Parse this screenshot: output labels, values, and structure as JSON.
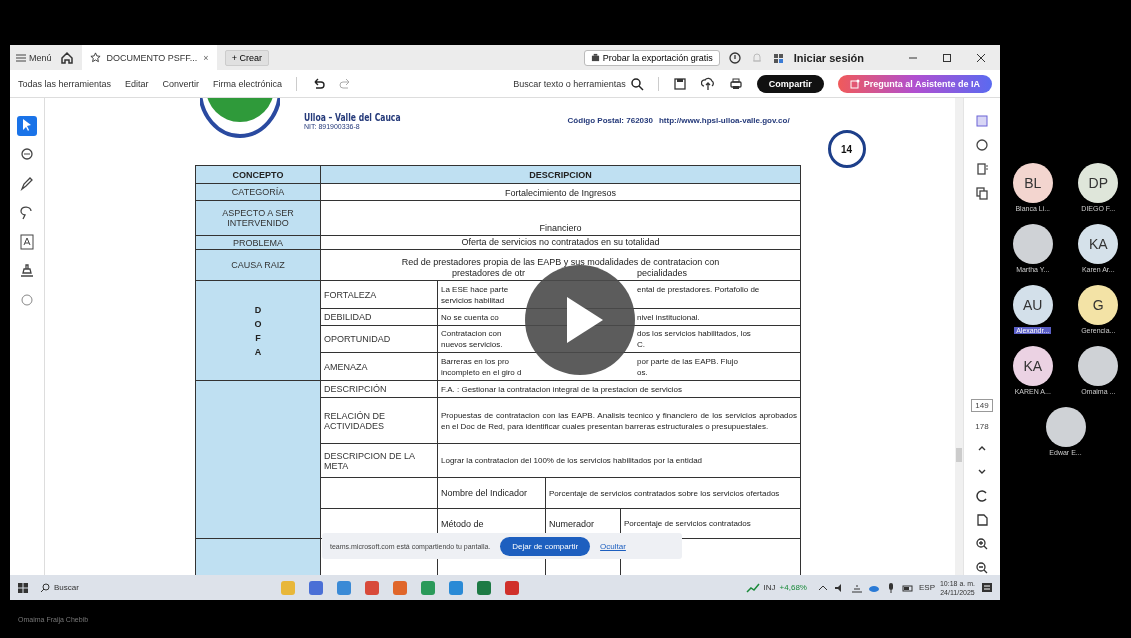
{
  "tab_bar": {
    "menu": "Menú",
    "tab_title": "DOCUMENTO PSFF...",
    "tab_close": "×",
    "create": "+ Crear",
    "try_export": "Probar la exportación gratis",
    "sign_in": "Iniciar sesión"
  },
  "toolbar": {
    "items": [
      "Todas las herramientas",
      "Editar",
      "Convertir",
      "Firma electrónica"
    ],
    "search": "Buscar texto o herramientas",
    "share": "Compartir",
    "ai": "Pregunta al Asistente de IA"
  },
  "left_tools": [
    {
      "kind": "pointer",
      "selected": true
    },
    {
      "kind": "comment",
      "selected": false
    },
    {
      "kind": "pen",
      "selected": false
    },
    {
      "kind": "lasso",
      "selected": false
    },
    {
      "kind": "text",
      "selected": false
    },
    {
      "kind": "stamp",
      "selected": false
    },
    {
      "kind": "circle",
      "selected": false
    }
  ],
  "document": {
    "header": {
      "town": "Ulloa – Valle del Cauca",
      "nit": "NIT: 891900336-8",
      "postal": "Código Postal: 762030",
      "url": "http://www.hpsl-ulloa-valle.gov.co/"
    },
    "page_badge": "14",
    "table": {
      "columns": [
        "CONCEPTO",
        "DESCRIPCION"
      ],
      "rows": [
        {
          "kind": "full",
          "label": "CATEGORÍA",
          "lines": [
            [
              "Fortalecimiento de Ingresos"
            ]
          ]
        },
        {
          "kind": "full",
          "label": "ASPECTO A SER INTERVENIDO",
          "lines": [
            [
              "Financiero"
            ]
          ]
        },
        {
          "kind": "full",
          "label": "PROBLEMA",
          "lines": [
            [
              "Oferta de servicios no contratados en su totalidad"
            ]
          ]
        },
        {
          "kind": "full",
          "label": "CAUSA RAIZ",
          "lines": [
            [
              "Red de prestadores propia de las EAPB y sus modalidades de contratacion con"
            ],
            [
              "prestadores de otr",
              "pecialidades"
            ]
          ]
        },
        {
          "kind": "group",
          "letters": [
            "D",
            "O",
            "F",
            "A"
          ],
          "children": [
            {
              "kind": "sub",
              "label": "FORTALEZA",
              "lines": [
                [
                  "La ESE hace parte",
                  "ental de prestadores. Portafolio de"
                ],
                [
                  "servicios habilitad"
                ]
              ]
            },
            {
              "kind": "sub",
              "label": "DEBILIDAD",
              "lines": [
                [
                  "No se cuenta co",
                  "nivel institucional."
                ]
              ]
            },
            {
              "kind": "sub",
              "label": "OPORTUNIDAD",
              "lines": [
                [
                  "Contratacion con",
                  "dos los servicios habilitados, los"
                ],
                [
                  "nuevos servicios.",
                  "C."
                ]
              ]
            },
            {
              "kind": "sub",
              "label": "AMENAZA",
              "lines": [
                [
                  "Barreras en los pro",
                  "por parte de las EAPB. Flujo"
                ],
                [
                  "incompleto en el giro d",
                  "os."
                ]
              ]
            }
          ]
        },
        {
          "kind": "group",
          "letters": [],
          "children": [
            {
              "kind": "sub",
              "label": "DESCRIPCIÓN",
              "lines": [
                [
                  "F.A. : Gestionar la contratacion integral de la prestacion de servicios"
                ]
              ]
            },
            {
              "kind": "sub",
              "label": "RELACIÓN DE ACTIVIDADES",
              "lines": [
                [
                  "Propuestas de contratacion con las EAPB. Analisis tecnico y financiero de los servicios aprobados en el Doc de Red, para identificar cuales presentan barreras estructurales o presupuestales."
                ]
              ]
            },
            {
              "kind": "sub",
              "label": "DESCRIPCION DE LA META",
              "lines": [
                [
                  "Lograr la contratacion del 100% de los servicios habilitados por la entidad"
                ]
              ]
            },
            {
              "kind": "indicator",
              "label": "Nombre del Indicador",
              "lines": [
                [
                  "Porcentaje de servicios contratados sobre los servicios ofertados"
                ]
              ]
            },
            {
              "kind": "method",
              "label": "Método de",
              "sublabel": "Numerador",
              "lines": [
                [
                  "Porcentaje de servicios contratados"
                ]
              ]
            }
          ]
        }
      ]
    }
  },
  "right_panel": {
    "page_current": "149",
    "page_total": "178"
  },
  "share_bar": {
    "message": "teams.microsoft.com está compartiendo tu pantalla.",
    "stop": "Dejar de compartir",
    "hide": "Ocultar"
  },
  "taskbar": {
    "search": "Buscar",
    "ticker": "INJ",
    "change": "+4,68%",
    "language": "ESP",
    "time": "10:18 a. m.",
    "date": "24/11/2025"
  },
  "participants": [
    {
      "kind": "initials",
      "initials": "BL",
      "name": "Blanca Li...",
      "color": "#f3d5cf",
      "selected": false
    },
    {
      "kind": "initials",
      "initials": "DP",
      "name": "DIEGO F...",
      "color": "#dfe6da",
      "selected": false
    },
    {
      "kind": "photo",
      "name": "Martha Y...",
      "selected": false
    },
    {
      "kind": "initials",
      "initials": "KA",
      "name": "Karen Ar...",
      "color": "#d5e1ea",
      "selected": false
    },
    {
      "kind": "initials",
      "initials": "AU",
      "name": "Alexandr...",
      "color": "#d3e0ea",
      "selected": true
    },
    {
      "kind": "initials",
      "initials": "G",
      "name": "Gerencia...",
      "color": "#f3e3a6",
      "selected": false
    },
    {
      "kind": "initials",
      "initials": "KA",
      "name": "KAREN A...",
      "color": "#ebd2e3",
      "selected": false
    },
    {
      "kind": "photo",
      "name": "Omaima ...",
      "selected": false
    },
    {
      "kind": "photo",
      "name": "Edwar E...",
      "selected": false
    }
  ],
  "presenter": "Omaima Fraija Chebib"
}
